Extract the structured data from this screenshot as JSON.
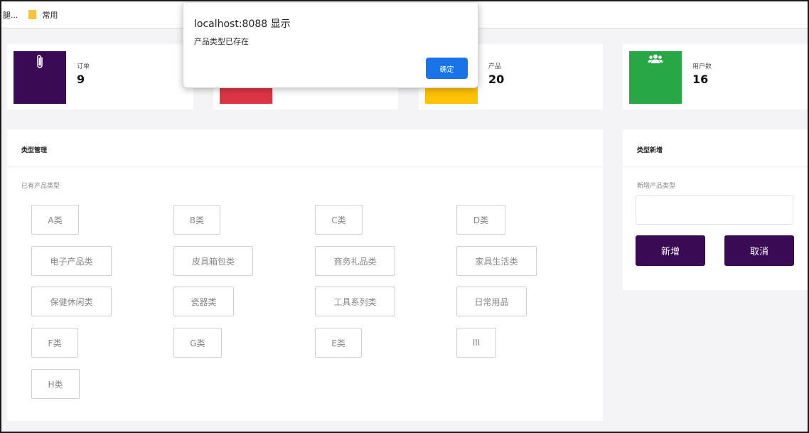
{
  "bookmarks": {
    "truncated_item": "腿...",
    "folder_label": "常用"
  },
  "dialog": {
    "title": "localhost:8088 显示",
    "message": "产品类型已存在",
    "ok_label": "确定"
  },
  "stats": [
    {
      "label": "订单",
      "value": "9",
      "color": "#3b0a55",
      "icon": "paperclip-icon"
    },
    {
      "label": "",
      "value": "",
      "color": "#dc3545",
      "icon": ""
    },
    {
      "label": "产品",
      "value": "20",
      "color": "#ffc107",
      "icon": ""
    },
    {
      "label": "用户数",
      "value": "16",
      "color": "#28a745",
      "icon": "users-icon"
    }
  ],
  "type_panel": {
    "title": "类型管理",
    "subtitle": "已有产品类型",
    "types": [
      "A类",
      "B类",
      "C类",
      "D类",
      "电子产品类",
      "皮具箱包类",
      "商务礼品类",
      "家具生活类",
      "保健休闲类",
      "瓷器类",
      "工具系列类",
      "日常用品",
      "F类",
      "G类",
      "E类",
      "III",
      "H类"
    ]
  },
  "add_panel": {
    "title": "类型新增",
    "field_label": "新增产品类型",
    "input_value": "",
    "input_placeholder": "",
    "add_label": "新增",
    "cancel_label": "取消"
  },
  "colors": {
    "accent_purple": "#3b0a55",
    "dialog_button": "#1a73e8"
  }
}
